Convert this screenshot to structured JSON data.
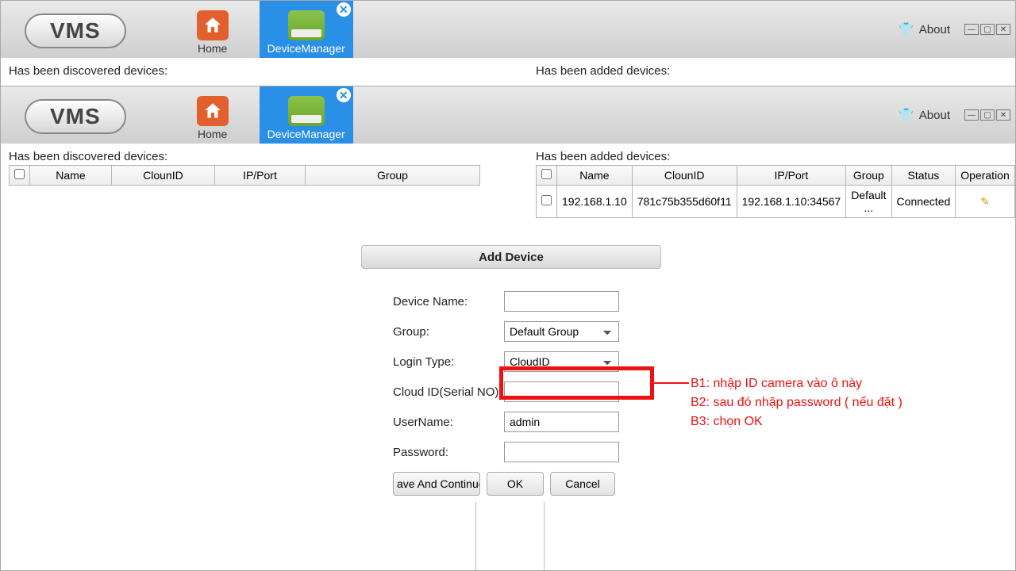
{
  "app": {
    "logo": "VMS",
    "about": "About"
  },
  "nav": {
    "home": "Home",
    "deviceManager": "DeviceManager"
  },
  "panes": {
    "discovered_label": "Has been discovered devices:",
    "added_label": "Has been added devices:"
  },
  "tables": {
    "discovered_headers": [
      "Name",
      "ClounID",
      "IP/Port",
      "Group"
    ],
    "added_headers": [
      "Name",
      "ClounID",
      "IP/Port",
      "Group",
      "Status",
      "Operation"
    ],
    "added_rows": [
      {
        "name": "192.168.1.10",
        "clounid": "781c75b355d60f11",
        "ipport": "192.168.1.10:34567",
        "group": "Default ...",
        "status": "Connected"
      }
    ]
  },
  "dialog": {
    "title": "Add Device",
    "labels": {
      "device_name": "Device Name:",
      "group": "Group:",
      "login_type": "Login Type:",
      "cloud_id": "Cloud ID(Serial NO):",
      "username": "UserName:",
      "password": "Password:"
    },
    "values": {
      "device_name": "",
      "group": "Default Group",
      "login_type": "CloudID",
      "cloud_id": "",
      "username": "admin",
      "password": ""
    },
    "buttons": {
      "save_cont": "ave And Continue",
      "ok": "OK",
      "cancel": "Cancel"
    }
  },
  "annotation": {
    "l1": "B1: nhập ID camera vào ô này",
    "l2": "B2: sau đó nhập password ( nếu đặt )",
    "l3": "B3: chọn OK"
  }
}
